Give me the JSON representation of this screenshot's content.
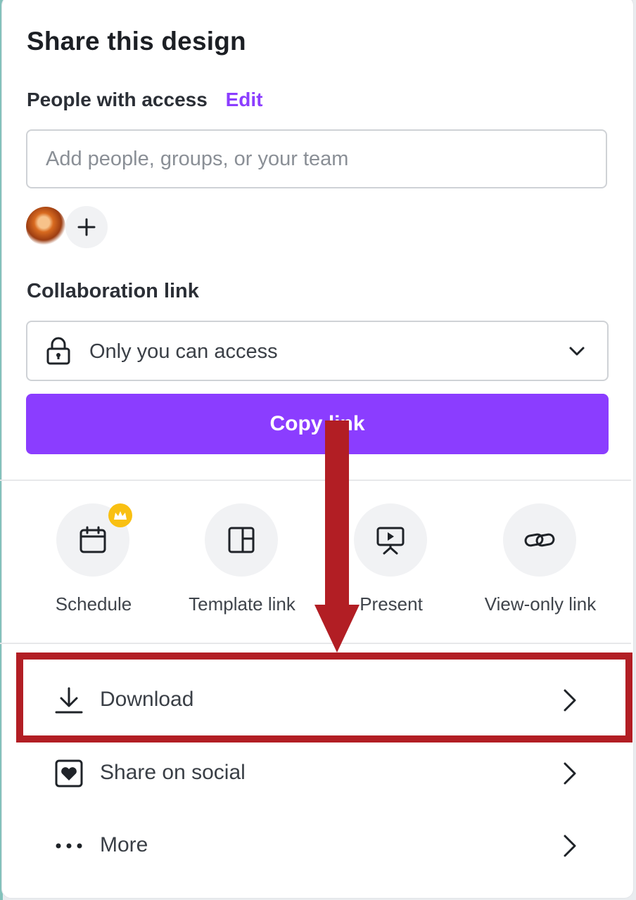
{
  "dialog": {
    "title": "Share this design",
    "people_label": "People with access",
    "edit_label": "Edit",
    "invite_placeholder": "Add people, groups, or your team",
    "collab_label": "Collaboration link",
    "access_value": "Only you can access",
    "copy_label": "Copy link"
  },
  "actions": [
    {
      "label": "Schedule",
      "icon": "calendar-icon",
      "badge": "crown-icon"
    },
    {
      "label": "Template link",
      "icon": "template-icon"
    },
    {
      "label": "Present",
      "icon": "present-icon"
    },
    {
      "label": "View-only link",
      "icon": "link-icon"
    }
  ],
  "menu": [
    {
      "label": "Download",
      "icon": "download-icon"
    },
    {
      "label": "Share on social",
      "icon": "heart-icon"
    },
    {
      "label": "More",
      "icon": "more-icon"
    }
  ],
  "colors": {
    "accent": "#8b3dff",
    "annotation": "#b21e24",
    "badge": "#f9c012"
  }
}
